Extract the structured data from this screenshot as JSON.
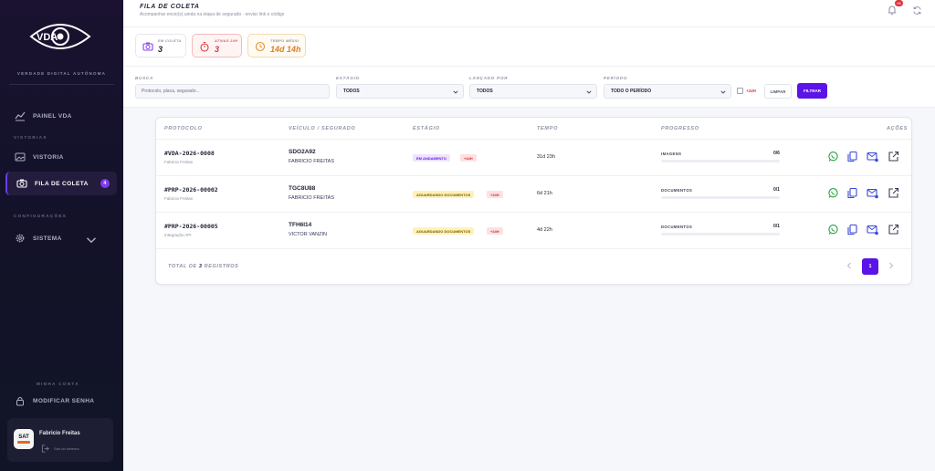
{
  "sidebar": {
    "brand": "VDA",
    "tagline": "VERDADE DIGITAL AUTÔNOMA",
    "items": {
      "painel": "PAINEL VDA",
      "vistorias_section": "VISTORIAS",
      "vistoria": "VISTORIA",
      "fila": "FILA DE COLETA",
      "fila_badge": "4",
      "config_section": "CONFIGURAÇÕES",
      "sistema": "SISTEMA",
      "account_section": "MINHA CONTA",
      "senha": "MODIFICAR SENHA"
    },
    "user": {
      "avatar": "SAT",
      "name": "Fabricio Freitas",
      "logout": "Sair do sistema"
    }
  },
  "header": {
    "title": "FILA DE COLETA",
    "subtitle": "Acompanhar envio(s) ainda na etapa de segurado · enviar link e código",
    "notification_count": "99"
  },
  "stats": [
    {
      "label": "EM COLETA",
      "value": "3"
    },
    {
      "label": "ATIVAS 24H",
      "value": "3"
    },
    {
      "label": "TEMPO MÉDIO",
      "value": "14d 14h"
    }
  ],
  "filters": {
    "search_label": "BUSCA",
    "search_placeholder": "Protocolo, placa, segurado...",
    "status_label": "ESTÁGIO",
    "status_value": "TODOS",
    "origin_label": "LANÇADO POR",
    "origin_value": "TODOS",
    "period_label": "PERÍODO",
    "period_value": "TODO O PERÍODO",
    "flag_24h": "+24H",
    "clear": "LIMPAR",
    "apply": "FILTRAR"
  },
  "table": {
    "headers": {
      "protocolo": "PROTOCOLO",
      "veiculo": "VEÍCULO / SEGURADO",
      "estagio": "ESTÁGIO",
      "tempo": "TEMPO",
      "progresso": "PROGRESSO",
      "acoes": "AÇÕES"
    },
    "rows": [
      {
        "protocol": "#VDA-2026-0008",
        "origin": "Fabricio Freitas",
        "plate": "SDO2A92",
        "client": "FABRICIO FREITAS",
        "stage": "EM ANDAMENTO",
        "flag": "+24H",
        "time": "31d 23h",
        "progress_label": "IMAGENS",
        "progress_count": "0/6",
        "progress": 0
      },
      {
        "protocol": "#PRP-2026-00002",
        "origin": "Fabricio Freitas",
        "plate": "TGC8U88",
        "client": "FABRICIO FREITAS",
        "stage": "AGUARDANDO DOCUMENTOS",
        "flag": "+24H",
        "time": "6d 21h",
        "progress_label": "DOCUMENTOS",
        "progress_count": "0/1",
        "progress": 0
      },
      {
        "protocol": "#PRP-2026-00005",
        "origin": "Integração API",
        "plate": "TFH6I14",
        "client": "VICTOR VANZIN",
        "stage": "AGUARDANDO DOCUMENTOS",
        "flag": "+24H",
        "time": "4d 22h",
        "progress_label": "DOCUMENTOS",
        "progress_count": "0/1",
        "progress": 0
      }
    ],
    "footer": {
      "prefix": "TOTAL DE ",
      "count": "3",
      "suffix": " REGISTROS"
    },
    "page": "1"
  },
  "colors": {
    "accent": "#5a14e8",
    "sidebar_bg": "#14122a",
    "danger": "#d83b3b"
  }
}
